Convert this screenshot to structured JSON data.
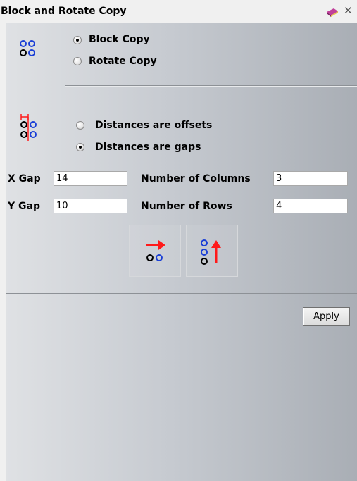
{
  "window": {
    "title": "Block and Rotate Copy",
    "close_glyph": "✕"
  },
  "copy_mode": {
    "icon": "circles-grid-icon",
    "options": [
      {
        "label": "Block Copy",
        "selected": true
      },
      {
        "label": "Rotate Copy",
        "selected": false
      }
    ]
  },
  "distance_mode": {
    "icon": "gap-measure-icon",
    "options": [
      {
        "label": "Distances are offsets",
        "selected": false
      },
      {
        "label": "Distances are gaps",
        "selected": true
      }
    ]
  },
  "fields": {
    "x_gap": {
      "label": "X Gap",
      "value": "14"
    },
    "y_gap": {
      "label": "Y Gap",
      "value": "10"
    },
    "columns": {
      "label": "Number of Columns",
      "value": "3"
    },
    "rows": {
      "label": "Number of Rows",
      "value": "4"
    }
  },
  "direction_buttons": [
    {
      "icon": "copy-right-arrow-icon"
    },
    {
      "icon": "copy-up-arrow-icon"
    }
  ],
  "apply_label": "Apply",
  "colors": {
    "blue": "#1a3fd6",
    "red": "#ff1a1a",
    "black": "#000000"
  }
}
